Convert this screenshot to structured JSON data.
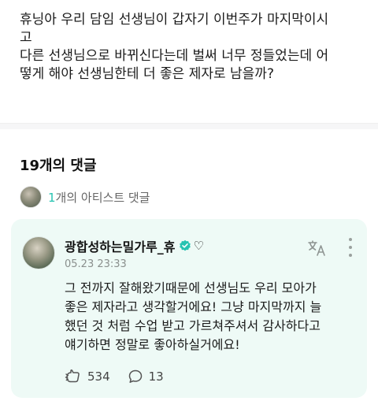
{
  "post": {
    "lines": [
      "휴닝아 우리 담임 선생님이 갑자기 이번주가 마지막이시",
      "고",
      "다른 선생님으로 바뀌신다는데 벌써 너무 정들었는데 어",
      "떻게 해야 선생님한테 더 좋은 제자로 남을까?"
    ]
  },
  "comments_header": {
    "count_label": "19개의 댓글"
  },
  "artist_comments": {
    "count": "1",
    "label": "개의 아티스트 댓글"
  },
  "comment": {
    "author": "광합성하는밀가루_휴",
    "author_suffix": "♡",
    "timestamp": "05.23 23:33",
    "text_lines": [
      "그 전까지 잘해왔기때문에 선생님도 우리 모아가",
      "좋은 제자라고 생각할거에요! 그냥 마지막까지 늘",
      "했던 것 처럼 수업 받고 가르쳐주셔서 감사하다고",
      "얘기하면 정말로 좋아하실거에요!"
    ],
    "likes": "534",
    "replies": "13",
    "icons": {
      "verified": "verified-check-icon",
      "translate": "translate-icon",
      "more": "more-vertical-icon",
      "like": "like-hand-icon",
      "reply": "reply-bubble-icon"
    }
  },
  "colors": {
    "accent": "#27c3b1",
    "card_background": "#eefaf6"
  }
}
